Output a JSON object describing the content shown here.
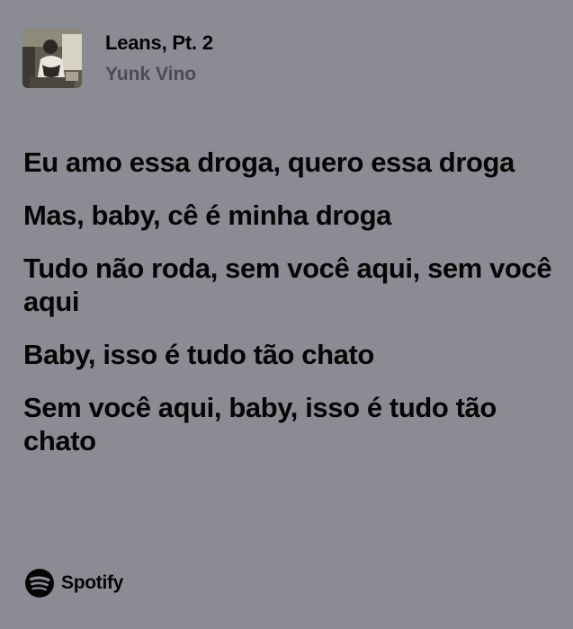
{
  "track": {
    "title": "Leans, Pt. 2",
    "artist": "Yunk Vino",
    "cover_icon": "album-cover-photo"
  },
  "lyrics": [
    "Eu amo essa droga, quero essa droga",
    "Mas, baby, cê é minha droga",
    "Tudo não roda, sem você aqui, sem você aqui",
    "Baby, isso é tudo tão chato",
    "Sem você aqui, baby, isso é tudo tão chato"
  ],
  "brand": {
    "name": "Spotify",
    "icon": "spotify-logo-icon"
  },
  "colors": {
    "background": "#8b8b93",
    "text": "#060606",
    "artist_text": "#4b4b52"
  }
}
